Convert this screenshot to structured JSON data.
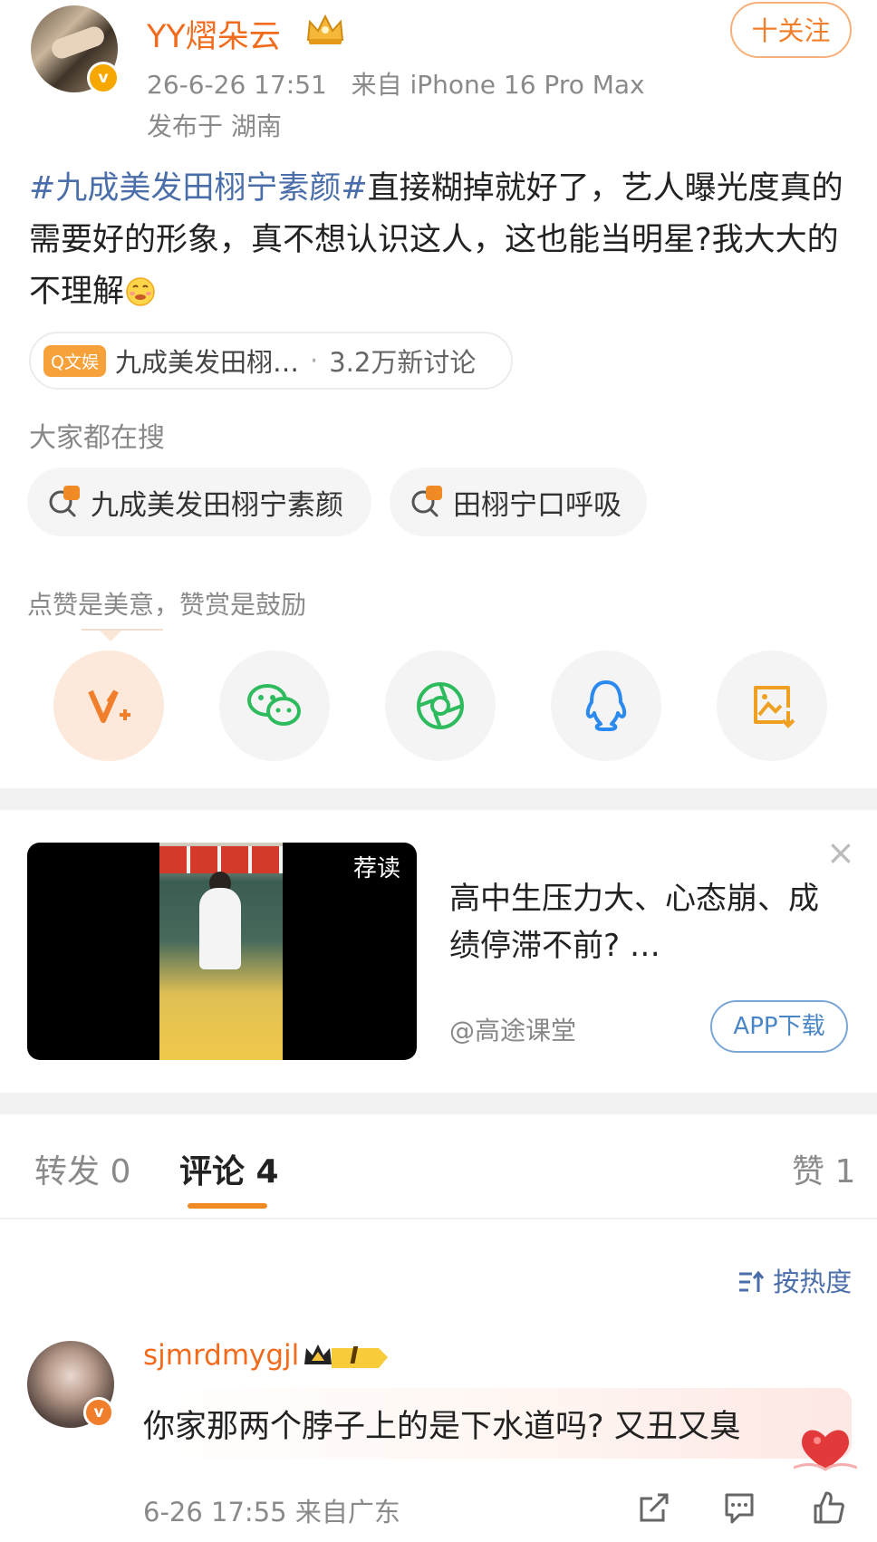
{
  "post": {
    "username": "YY熠朵云",
    "time": "26-6-26 17:51",
    "source": "来自 iPhone 16 Pro Max",
    "location": "发布于 湖南",
    "follow_label": "十关注",
    "hashtag": "#九成美发田栩宁素颜#",
    "text": "直接糊掉就好了，艺人曝光度真的需要好的形象，真不想认识这人，这也能当明星?我大大的不理解",
    "topic": {
      "badge": "Q文娱",
      "name": "九成美发田栩…",
      "separator": "·",
      "count": "3.2万新讨论"
    }
  },
  "search": {
    "label": "大家都在搜",
    "items": [
      "九成美发田栩宁素颜",
      "田栩宁口呼吸"
    ]
  },
  "reward": {
    "label": "点赞是美意，赞赏是鼓励",
    "share_icons": [
      "weibo-reward-icon",
      "wechat-icon",
      "moments-icon",
      "qq-icon",
      "save-image-icon"
    ]
  },
  "ad": {
    "tag": "荐读",
    "title": "高中生压力大、心态崩、成绩停滞不前? …",
    "source": "@高途课堂",
    "button": "APP下载",
    "close": "×"
  },
  "tabs": {
    "repost": "转发 0",
    "comment": "评论 4",
    "like": "赞 1"
  },
  "sort_label": "按热度",
  "comment": {
    "username": "sjmrdmygjl",
    "level": "I",
    "text": "你家那两个脖子上的是下水道吗? 又丑又臭",
    "meta": "6-26 17:55 来自广东"
  },
  "colors": {
    "accent_orange": "#f26b1d",
    "link_blue": "#4a6ea9",
    "badge_gold": "#f6a800"
  }
}
